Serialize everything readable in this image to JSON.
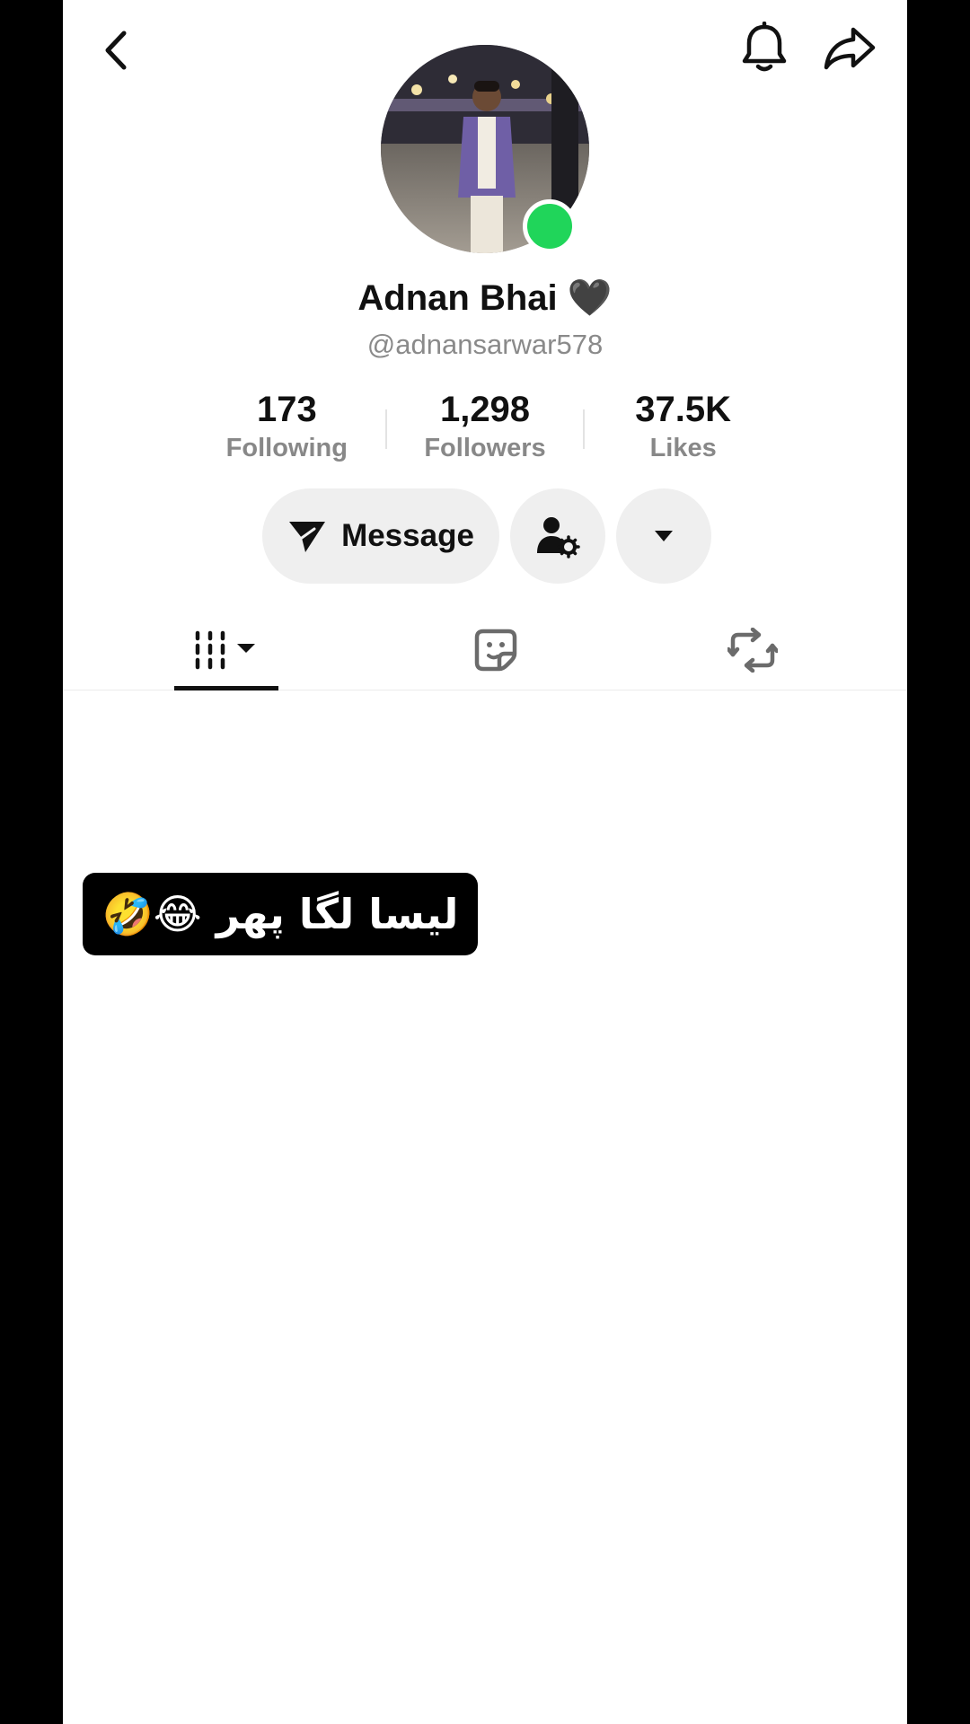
{
  "profile": {
    "display_name": "Adnan Bhai 🖤",
    "username": "@adnansarwar578",
    "online_color": "#20d55a"
  },
  "stats": [
    {
      "value": "173",
      "label": "Following"
    },
    {
      "value": "1,298",
      "label": "Followers"
    },
    {
      "value": "37.5K",
      "label": "Likes"
    }
  ],
  "actions": {
    "message_label": "Message"
  },
  "tabs": [
    {
      "icon": "grid-icon",
      "active": true
    },
    {
      "icon": "sticker-icon",
      "active": false
    },
    {
      "icon": "repost-icon",
      "active": false
    }
  ],
  "post": {
    "caption": "لیسا لگا پھر 😂🤣"
  },
  "icons": {
    "back": "chevron-left-icon",
    "notifications": "bell-icon",
    "share": "share-arrow-icon"
  }
}
